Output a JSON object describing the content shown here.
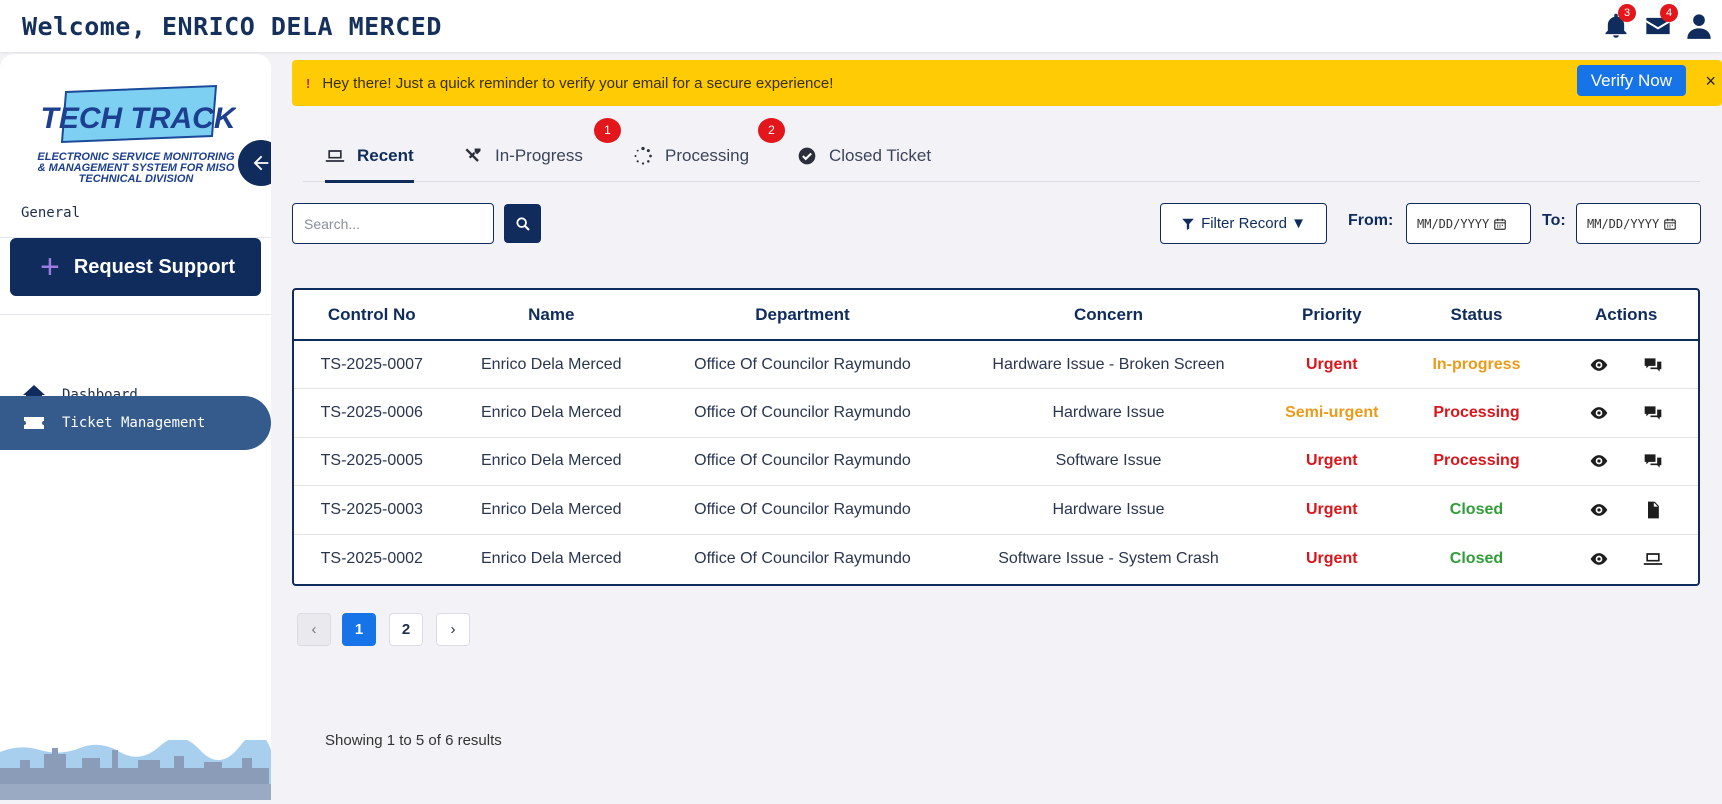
{
  "header": {
    "welcome": "Welcome, ENRICO DELA MERCED",
    "notification_count": "3",
    "message_count": "4",
    "icons": [
      "bell-icon",
      "envelope-icon",
      "user-icon"
    ]
  },
  "sidebar": {
    "logo_title": "TECH TRACK",
    "logo_subtitle_1": "ELECTRONIC SERVICE MONITORING",
    "logo_subtitle_2": "& MANAGEMENT SYSTEM FOR MISO",
    "logo_subtitle_3": "TECHNICAL DIVISION",
    "section_label": "General",
    "request_button": "Request Support",
    "nav": [
      {
        "label": "Dashboard",
        "icon": "home-icon",
        "active": false
      },
      {
        "label": "Ticket Management",
        "icon": "ticket-icon",
        "active": true
      }
    ]
  },
  "alert": {
    "icon": "!",
    "message": "Hey there! Just a quick reminder to verify your email for a secure experience!",
    "verify_label": "Verify Now",
    "close_label": "×"
  },
  "tabs": [
    {
      "label": "Recent",
      "icon": "laptop-icon",
      "active": true
    },
    {
      "label": "In-Progress",
      "icon": "tools-icon",
      "badge": "1"
    },
    {
      "label": "Processing",
      "icon": "spinner-icon",
      "badge": "2"
    },
    {
      "label": "Closed Ticket",
      "icon": "check-circle-icon"
    }
  ],
  "search": {
    "placeholder": "Search..."
  },
  "filter": {
    "label": "Filter Record ▼",
    "from_label": "From:",
    "to_label": "To:",
    "date_placeholder": "MM/DD/YYYY"
  },
  "table": {
    "columns": [
      "Control No",
      "Name",
      "Department",
      "Concern",
      "Priority",
      "Status",
      "Actions"
    ],
    "rows": [
      {
        "control": "TS-2025-0007",
        "name": "Enrico Dela Merced",
        "department": "Office Of Councilor Raymundo",
        "concern": "Hardware Issue - Broken Screen",
        "priority": "Urgent",
        "status": "In-progress",
        "actions": [
          "eye-icon",
          "comments-icon"
        ]
      },
      {
        "control": "TS-2025-0006",
        "name": "Enrico Dela Merced",
        "department": "Office Of Councilor Raymundo",
        "concern": "Hardware Issue",
        "priority": "Semi-urgent",
        "status": "Processing",
        "actions": [
          "eye-icon",
          "comments-icon"
        ]
      },
      {
        "control": "TS-2025-0005",
        "name": "Enrico Dela Merced",
        "department": "Office Of Councilor Raymundo",
        "concern": "Software Issue",
        "priority": "Urgent",
        "status": "Processing",
        "actions": [
          "eye-icon",
          "comments-icon"
        ]
      },
      {
        "control": "TS-2025-0003",
        "name": "Enrico Dela Merced",
        "department": "Office Of Councilor Raymundo",
        "concern": "Hardware Issue",
        "priority": "Urgent",
        "status": "Closed",
        "actions": [
          "eye-icon",
          "file-icon"
        ]
      },
      {
        "control": "TS-2025-0002",
        "name": "Enrico Dela Merced",
        "department": "Office Of Councilor Raymundo",
        "concern": "Software Issue - System Crash",
        "priority": "Urgent",
        "status": "Closed",
        "actions": [
          "eye-icon",
          "laptop-icon"
        ]
      }
    ]
  },
  "pagination": {
    "prev": "‹",
    "pages": [
      "1",
      "2"
    ],
    "current": "1",
    "next": "›"
  },
  "footer": {
    "showing": "Showing 1 to 5 of 6 results"
  },
  "colors": {
    "primary": "#0f2c5c",
    "alert": "#ffcb05",
    "accent": "#1773e8",
    "urgent": "#d8161b",
    "semi_urgent": "#eb9b17",
    "closed": "#2f9e37"
  }
}
